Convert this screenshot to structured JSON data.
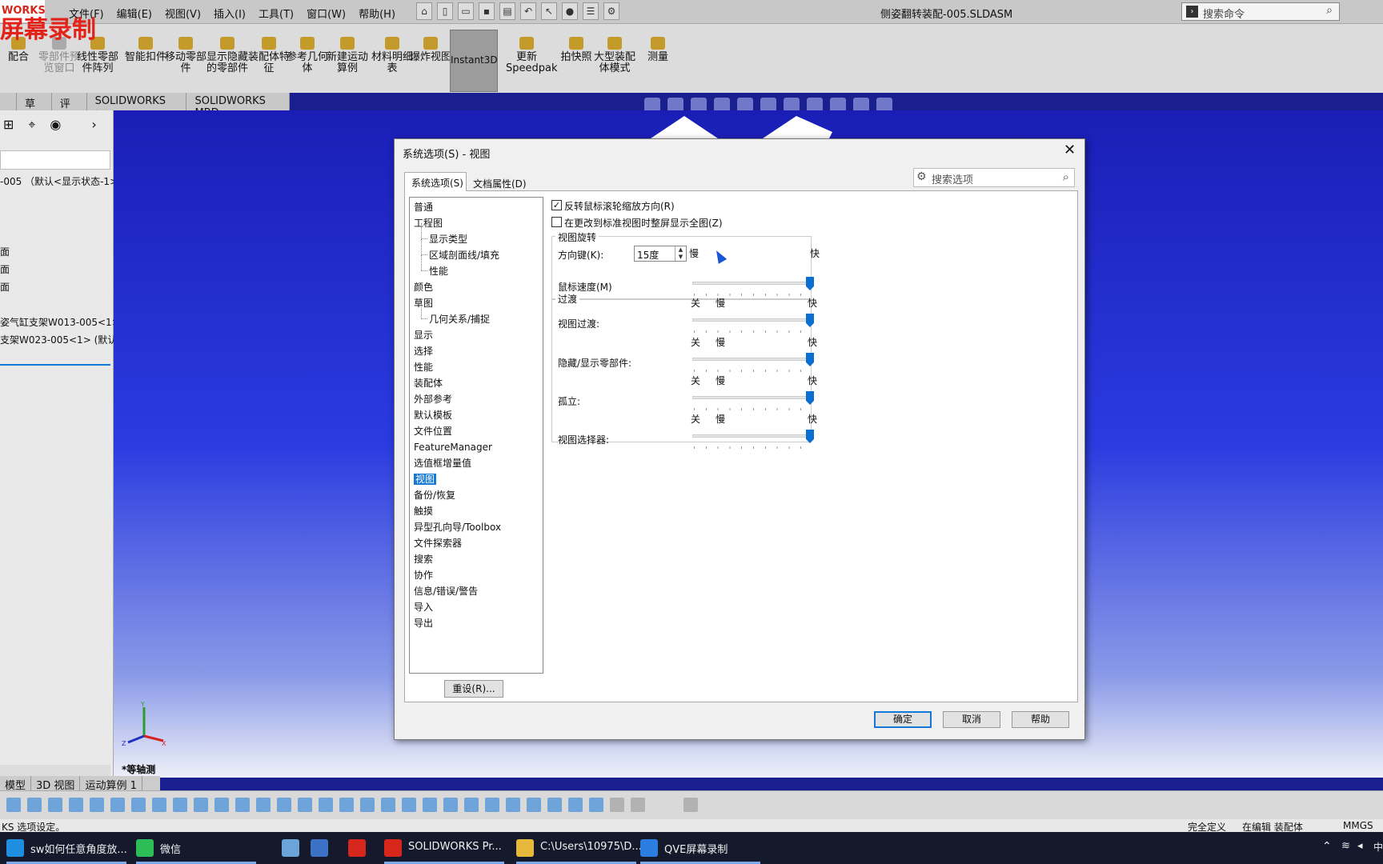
{
  "app": {
    "logo": "WORKS",
    "recording_overlay": "屏幕录制",
    "menus": [
      "文件(F)",
      "编辑(E)",
      "视图(V)",
      "插入(I)",
      "工具(T)",
      "窗口(W)",
      "帮助(H)"
    ],
    "title": "侧姿翻转装配-005.SLDASM",
    "command_search_placeholder": "搜索命令"
  },
  "toolbar": {
    "tools": [
      {
        "label": "配合",
        "enabled": true
      },
      {
        "label": "零部件预览窗口",
        "enabled": false
      },
      {
        "label": "线性零部件阵列",
        "enabled": true
      },
      {
        "label": "智能扣件",
        "enabled": true
      },
      {
        "label": "移动零部件",
        "enabled": true
      },
      {
        "label": "显示隐藏的零部件",
        "enabled": true
      },
      {
        "label": "装配体特征",
        "enabled": true
      },
      {
        "label": "参考几何体",
        "enabled": true
      },
      {
        "label": "新建运动算例",
        "enabled": true
      },
      {
        "label": "材料明细表",
        "enabled": true
      },
      {
        "label": "爆炸视图",
        "enabled": true
      },
      {
        "label": "更新Speedpak",
        "enabled": true
      },
      {
        "label": "拍快照",
        "enabled": true
      },
      {
        "label": "大型装配体模式",
        "enabled": true
      },
      {
        "label": "测量",
        "enabled": true
      }
    ],
    "instant3d": "Instant3D",
    "tabs": [
      "草图",
      "评估",
      "SOLIDWORKS 插件",
      "SOLIDWORKS MBD"
    ]
  },
  "feature_tree": {
    "items": [
      "-005 （默认<显示状态-1>",
      "面",
      "面",
      "面",
      "姿气缸支架W013-005<1>",
      "支架W023-005<1> (默认"
    ]
  },
  "graphics": {
    "view_label": "*等轴测",
    "bottom_tabs": [
      "模型",
      "3D 视图",
      "运动算例 1"
    ]
  },
  "status": {
    "left": "KS 选项设定。",
    "mid1": "完全定义",
    "mid2": "在编辑 装配体",
    "units": "MMGS"
  },
  "taskbar": {
    "items": [
      {
        "label": "sw如何任意角度放...",
        "color": "#1f8ee0"
      },
      {
        "label": "微信",
        "color": "#2dbd57"
      },
      {
        "label": "SOLIDWORKS Pr...",
        "color": "#d7261c"
      },
      {
        "label": "C:\\Users\\10975\\D...",
        "color": "#e6b83a"
      },
      {
        "label": "QVE屏幕录制",
        "color": "#2b7de0"
      }
    ],
    "tray_text": "中"
  },
  "dialog": {
    "title": "系统选项(S) - 视图",
    "tab_system": "系统选项(S)",
    "tab_doc": "文档属性(D)",
    "search_placeholder": "搜索选项",
    "tree": [
      "普通",
      "工程图",
      "显示类型",
      "区域剖面线/填充",
      "性能",
      "颜色",
      "草图",
      "几何关系/捕捉",
      "显示",
      "选择",
      "性能",
      "装配体",
      "外部参考",
      "默认模板",
      "文件位置",
      "FeatureManager",
      "选值框增量值",
      "视图",
      "备份/恢复",
      "触摸",
      "异型孔向导/Toolbox",
      "文件探索器",
      "搜索",
      "协作",
      "信息/错误/警告",
      "导入",
      "导出"
    ],
    "selected_index": 17,
    "reset": "重设(R)...",
    "option_reverse_wheel": {
      "label": "反转鼠标滚轮缩放方向(R)",
      "checked": true
    },
    "option_zoom_fit": {
      "label": "在更改到标准视图时整屏显示全图(Z)",
      "checked": false
    },
    "view_rotation": {
      "title": "视图旋转",
      "arrow_keys_label": "方向键(K):",
      "arrow_keys_value": "15度",
      "mouse_speed_label": "鼠标速度(M)",
      "slow": "慢",
      "fast": "快",
      "mouse_speed_value": 1.0
    },
    "transition": {
      "title": "过渡",
      "off": "关",
      "slow": "慢",
      "fast": "快",
      "rows": [
        {
          "label": "视图过渡:",
          "value": 1.0
        },
        {
          "label": "隐藏/显示零部件:",
          "value": 1.0
        },
        {
          "label": "孤立:",
          "value": 1.0
        },
        {
          "label": "视图选择器:",
          "value": 1.0
        }
      ]
    },
    "ok": "确定",
    "cancel": "取消",
    "help": "帮助"
  }
}
